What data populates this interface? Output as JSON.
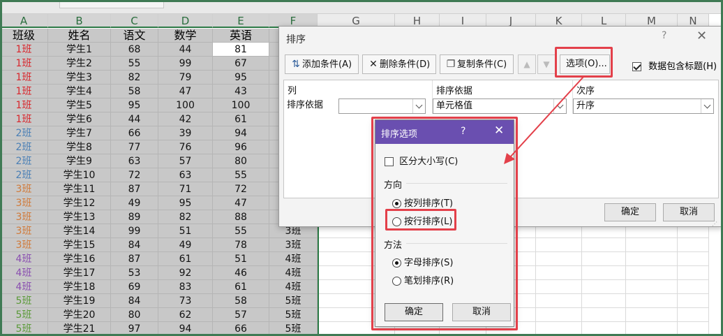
{
  "column_letters": [
    "A",
    "B",
    "C",
    "D",
    "E",
    "F",
    "G",
    "H",
    "I",
    "J",
    "K",
    "L",
    "M",
    "N"
  ],
  "table_headers": [
    "班级",
    "姓名",
    "语文",
    "数学",
    "英语"
  ],
  "rows": [
    {
      "class": "1班",
      "name": "学生1",
      "chinese": "68",
      "math": "44",
      "english": "81"
    },
    {
      "class": "1班",
      "name": "学生2",
      "chinese": "55",
      "math": "99",
      "english": "67"
    },
    {
      "class": "1班",
      "name": "学生3",
      "chinese": "82",
      "math": "79",
      "english": "95"
    },
    {
      "class": "1班",
      "name": "学生4",
      "chinese": "58",
      "math": "47",
      "english": "43"
    },
    {
      "class": "1班",
      "name": "学生5",
      "chinese": "95",
      "math": "100",
      "english": "100"
    },
    {
      "class": "1班",
      "name": "学生6",
      "chinese": "44",
      "math": "42",
      "english": "61"
    },
    {
      "class": "2班",
      "name": "学生7",
      "chinese": "66",
      "math": "39",
      "english": "94"
    },
    {
      "class": "2班",
      "name": "学生8",
      "chinese": "77",
      "math": "76",
      "english": "96"
    },
    {
      "class": "2班",
      "name": "学生9",
      "chinese": "63",
      "math": "57",
      "english": "80"
    },
    {
      "class": "2班",
      "name": "学生10",
      "chinese": "72",
      "math": "63",
      "english": "55"
    },
    {
      "class": "3班",
      "name": "学生11",
      "chinese": "87",
      "math": "71",
      "english": "72"
    },
    {
      "class": "3班",
      "name": "学生12",
      "chinese": "49",
      "math": "95",
      "english": "47"
    },
    {
      "class": "3班",
      "name": "学生13",
      "chinese": "89",
      "math": "82",
      "english": "88"
    },
    {
      "class": "3班",
      "name": "学生14",
      "chinese": "99",
      "math": "51",
      "english": "55",
      "col_f": "3班"
    },
    {
      "class": "3班",
      "name": "学生15",
      "chinese": "84",
      "math": "49",
      "english": "78",
      "col_f": "3班"
    },
    {
      "class": "4班",
      "name": "学生16",
      "chinese": "87",
      "math": "61",
      "english": "51",
      "col_f": "4班"
    },
    {
      "class": "4班",
      "name": "学生17",
      "chinese": "53",
      "math": "92",
      "english": "46",
      "col_f": "4班"
    },
    {
      "class": "4班",
      "name": "学生18",
      "chinese": "69",
      "math": "83",
      "english": "61",
      "col_f": "4班"
    },
    {
      "class": "5班",
      "name": "学生19",
      "chinese": "84",
      "math": "73",
      "english": "58",
      "col_f": "5班"
    },
    {
      "class": "5班",
      "name": "学生20",
      "chinese": "80",
      "math": "62",
      "english": "57",
      "col_f": "5班"
    },
    {
      "class": "5班",
      "name": "学生21",
      "chinese": "97",
      "math": "94",
      "english": "66",
      "col_f": "5班"
    }
  ],
  "class_colors": {
    "1班": "#d8262c",
    "2班": "#4a7fb5",
    "3班": "#d07a3a",
    "4班": "#8a4fb0",
    "5班": "#5c9a3a"
  },
  "sort_dialog": {
    "title": "排序",
    "help": "?",
    "close": "✕",
    "add_condition": "添加条件(A)",
    "delete_condition": "删除条件(D)",
    "copy_condition": "复制条件(C)",
    "move_up": "▲",
    "move_down": "▼",
    "options": "选项(O)...",
    "has_headers_label": "数据包含标题(H)",
    "has_headers_checked": true,
    "col_header": "列",
    "sort_on_header": "排序依据",
    "order_header": "次序",
    "row_label": "排序依据",
    "column_value": "",
    "sort_on_value": "单元格值",
    "order_value": "升序",
    "ok": "确定",
    "cancel": "取消"
  },
  "options_dialog": {
    "title": "排序选项",
    "help": "?",
    "close": "✕",
    "case_sensitive": "区分大小写(C)",
    "case_sensitive_checked": false,
    "direction_label": "方向",
    "by_column": "按列排序(T)",
    "by_row": "按行排序(L)",
    "direction_selected": "by_column",
    "method_label": "方法",
    "by_letter": "字母排序(S)",
    "by_stroke": "笔划排序(R)",
    "method_selected": "by_letter",
    "ok": "确定",
    "cancel": "取消"
  },
  "colors": {
    "frame": "#3f7a54",
    "highlight": "#e3404a",
    "options_title_bar": "#6a4fb0",
    "selection_gray": "#c8c8c8"
  }
}
